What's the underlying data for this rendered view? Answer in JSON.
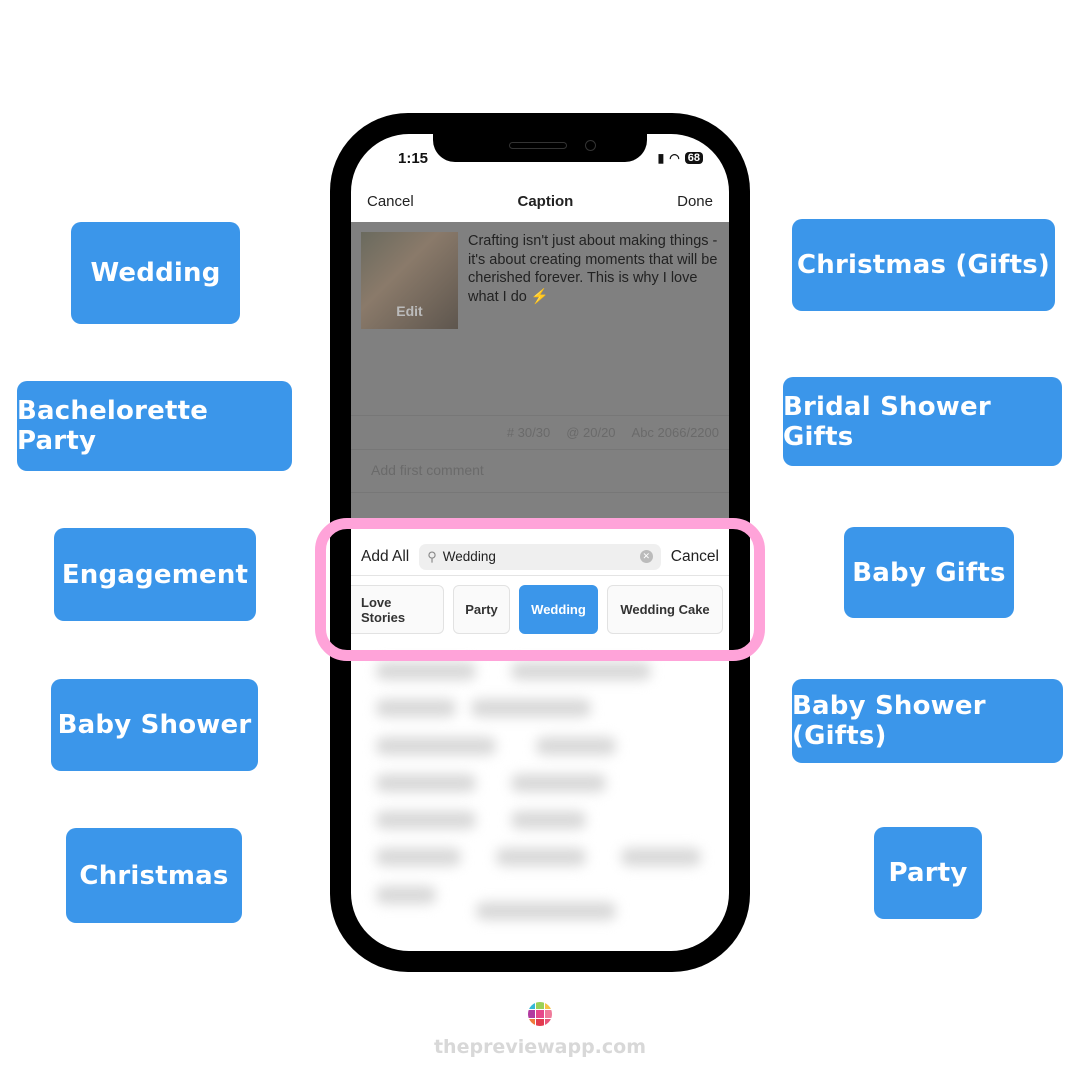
{
  "left_tags": [
    "Wedding",
    "Bachelorette Party",
    "Engagement",
    "Baby Shower",
    "Christmas"
  ],
  "right_tags": [
    "Christmas (Gifts)",
    "Bridal Shower Gifts",
    "Baby Gifts",
    "Baby Shower (Gifts)",
    "Party"
  ],
  "status": {
    "time": "1:15",
    "battery": "68"
  },
  "nav": {
    "cancel": "Cancel",
    "title": "Caption",
    "done": "Done"
  },
  "post": {
    "thumb_edit": "Edit",
    "caption": "Crafting isn't just about making things - it's about creating moments that will be cherished forever. This is why I love what I do ⚡"
  },
  "counts": {
    "hashtags": "# 30/30",
    "mentions": "@ 20/20",
    "chars": "Abc 2066/2200"
  },
  "comment_placeholder": "Add first comment",
  "search": {
    "add_all": "Add All",
    "value": "Wedding",
    "cancel": "Cancel"
  },
  "chips": [
    {
      "label": "Love Stories",
      "active": false
    },
    {
      "label": "Party",
      "active": false
    },
    {
      "label": "Wedding",
      "active": true
    },
    {
      "label": "Wedding Cake",
      "active": false
    }
  ],
  "footer": {
    "site": "thepreviewapp.com"
  },
  "colors": {
    "tag_blue": "#3b96ea",
    "highlight_pink": "#ffa3d9"
  }
}
